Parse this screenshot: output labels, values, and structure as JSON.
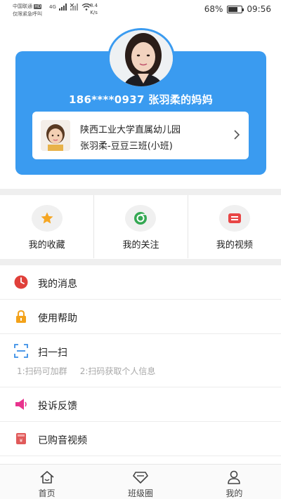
{
  "status_bar": {
    "carrier": "中国联通",
    "hd": "HD",
    "emergency": "仅限紧急呼叫",
    "network": "4G",
    "speed_value": "8.4",
    "speed_unit": "K/s",
    "battery": "68%",
    "battery_level": 0.68,
    "time": "09:56"
  },
  "profile": {
    "parent_name": "186****0937 张羽柔的妈妈",
    "school": "陕西工业大学直属幼儿园",
    "child_class": "张羽柔-豆豆三班(小班)"
  },
  "quick_actions": [
    {
      "label": "我的收藏",
      "icon": "star-icon",
      "color": "#f5a623"
    },
    {
      "label": "我的关注",
      "icon": "chrome-icon",
      "color": "#34a853"
    },
    {
      "label": "我的视频",
      "icon": "video-ticket-icon",
      "color": "#e84545"
    }
  ],
  "menu": {
    "messages": "我的消息",
    "help": "使用帮助",
    "scan": "扫一扫",
    "scan_hint_1": "1:扫码可加群",
    "scan_hint_2": "2:扫码获取个人信息",
    "feedback": "投诉反馈",
    "purchased": "已购音视频"
  },
  "bottom_nav": {
    "home": "首页",
    "class_circle": "班级圈",
    "mine": "我的"
  },
  "colors": {
    "primary": "#3a9bf0",
    "red": "#e0403a",
    "orange": "#f3a21a",
    "blue_scan": "#3a8ee6",
    "pink": "#e8338d"
  }
}
